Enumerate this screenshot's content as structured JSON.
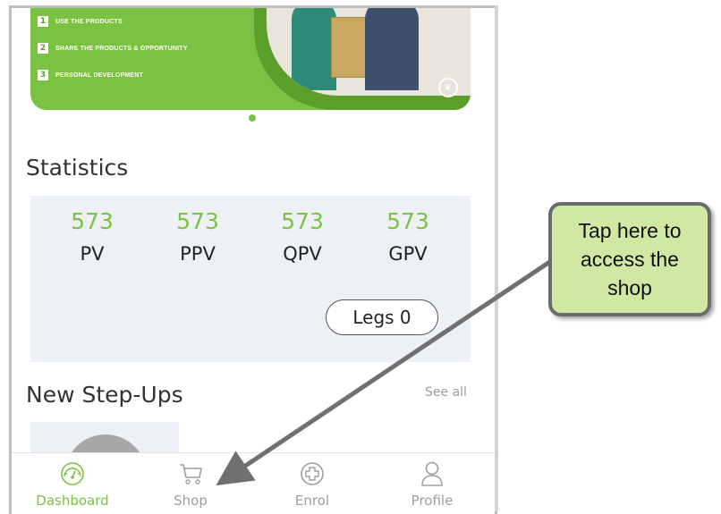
{
  "banner": {
    "items": [
      {
        "num": "1",
        "text": "USE THE PRODUCTS"
      },
      {
        "num": "2",
        "text": "SHARE THE PRODUCTS & OPPORTUNITY"
      },
      {
        "num": "3",
        "text": "PERSONAL DEVELOPMENT"
      }
    ],
    "logo_icon": "leaf-logo-icon"
  },
  "statistics": {
    "title": "Statistics",
    "items": [
      {
        "value": "573",
        "label": "PV"
      },
      {
        "value": "573",
        "label": "PPV"
      },
      {
        "value": "573",
        "label": "QPV"
      },
      {
        "value": "573",
        "label": "GPV"
      }
    ],
    "legs_label": "Legs 0"
  },
  "step_ups": {
    "title": "New Step-Ups",
    "see_all": "See all"
  },
  "nav": {
    "items": [
      {
        "label": "Dashboard",
        "icon": "dashboard-gauge-icon",
        "active": true
      },
      {
        "label": "Shop",
        "icon": "cart-icon",
        "active": false
      },
      {
        "label": "Enrol",
        "icon": "plus-circle-icon",
        "active": false
      },
      {
        "label": "Profile",
        "icon": "person-icon",
        "active": false
      }
    ]
  },
  "callout": {
    "lines": [
      "Tap here to",
      "access the",
      "shop"
    ]
  },
  "colors": {
    "accent_green": "#7cc242",
    "callout_fill": "#cfe8a3",
    "nav_inactive": "#9e9e9e"
  }
}
